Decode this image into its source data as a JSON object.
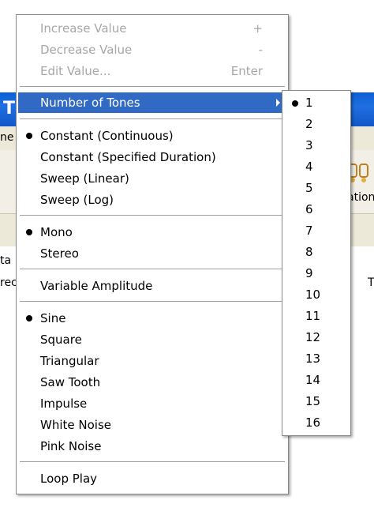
{
  "background": {
    "title_fragment": "T",
    "strip_fragment": "ne",
    "toolbar_fragment": "ation",
    "col1_fragment": "ta",
    "col2_fragment": "rec",
    "col3_fragment": "T"
  },
  "menu": {
    "value_group": [
      {
        "label": "Increase Value",
        "accel": "+"
      },
      {
        "label": "Decrease Value",
        "accel": "-"
      },
      {
        "label": "Edit Value...",
        "accel": "Enter"
      }
    ],
    "tones_item": {
      "label": "Number of Tones"
    },
    "mode_group": [
      {
        "label": "Constant (Continuous)",
        "checked": true
      },
      {
        "label": "Constant (Specified Duration)",
        "checked": false
      },
      {
        "label": "Sweep (Linear)",
        "checked": false
      },
      {
        "label": "Sweep (Log)",
        "checked": false
      }
    ],
    "channel_group": [
      {
        "label": "Mono",
        "checked": true
      },
      {
        "label": "Stereo",
        "checked": false
      }
    ],
    "amplitude_item": {
      "label": "Variable Amplitude"
    },
    "waveform_group": [
      {
        "label": "Sine",
        "checked": true
      },
      {
        "label": "Square",
        "checked": false
      },
      {
        "label": "Triangular",
        "checked": false
      },
      {
        "label": "Saw Tooth",
        "checked": false
      },
      {
        "label": "Impulse",
        "checked": false
      },
      {
        "label": "White Noise",
        "checked": false
      },
      {
        "label": "Pink Noise",
        "checked": false
      }
    ],
    "loop_item": {
      "label": "Loop Play"
    }
  },
  "submenu": {
    "items": [
      "1",
      "2",
      "3",
      "4",
      "5",
      "6",
      "7",
      "8",
      "9",
      "10",
      "11",
      "12",
      "13",
      "14",
      "15",
      "16"
    ],
    "selected_index": 0
  },
  "colors": {
    "highlight": "#316ac5",
    "disabled_text": "#a7a7a7"
  }
}
